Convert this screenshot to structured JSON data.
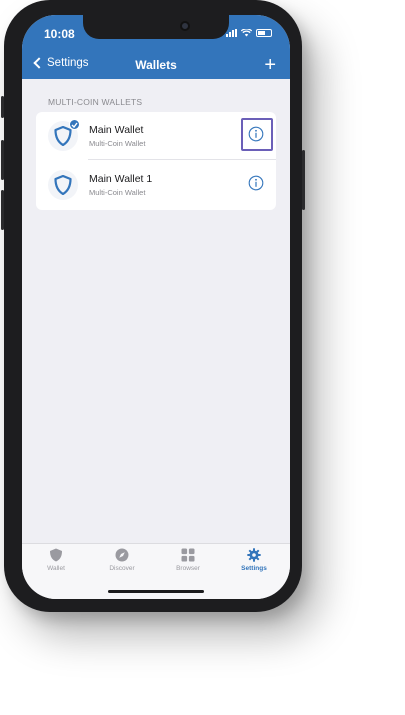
{
  "status_bar": {
    "time": "10:08"
  },
  "nav": {
    "back_label": "Settings",
    "title": "Wallets",
    "add_icon": "plus-icon"
  },
  "section": {
    "header": "MULTI-COIN WALLETS"
  },
  "wallets": [
    {
      "name": "Main Wallet",
      "subtitle": "Multi-Coin Wallet",
      "selected": true
    },
    {
      "name": "Main Wallet 1",
      "subtitle": "Multi-Coin Wallet",
      "selected": false
    }
  ],
  "tabs": [
    {
      "label": "Wallet",
      "icon": "shield-icon",
      "active": false
    },
    {
      "label": "Discover",
      "icon": "compass-icon",
      "active": false
    },
    {
      "label": "Browser",
      "icon": "grid-icon",
      "active": false
    },
    {
      "label": "Settings",
      "icon": "gear-icon",
      "active": true
    }
  ],
  "colors": {
    "brand": "#3375bb",
    "highlight": "#6b5fb8",
    "background": "#efeff4"
  }
}
